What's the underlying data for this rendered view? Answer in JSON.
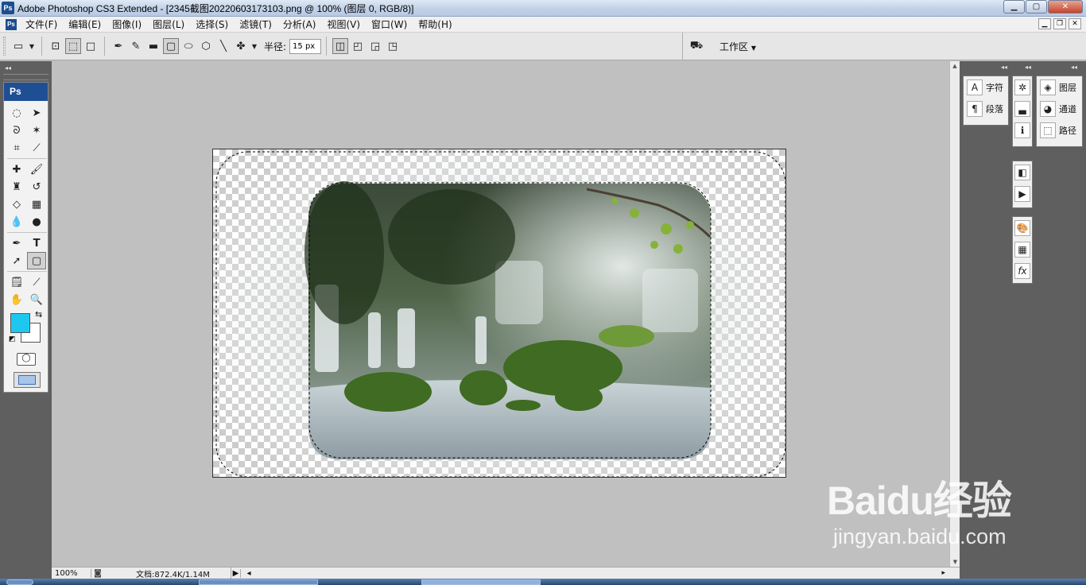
{
  "app": {
    "icon": "Ps",
    "title": "Adobe Photoshop CS3 Extended - [2345截图20220603173103.png @ 100% (图层 0, RGB/8)]"
  },
  "window_controls": [
    "minimize",
    "maximize",
    "close"
  ],
  "menus": [
    "文件(F)",
    "编辑(E)",
    "图像(I)",
    "图层(L)",
    "选择(S)",
    "滤镜(T)",
    "分析(A)",
    "视图(V)",
    "窗口(W)",
    "帮助(H)"
  ],
  "options_bar": {
    "radius_label": "半径:",
    "radius_value": "15 px",
    "workspace_label": "工作区"
  },
  "toolbox": {
    "logo": "Ps",
    "foreground_color": "#1dc8f0",
    "background_color": "#ffffff"
  },
  "panels": {
    "col1": [
      {
        "label": "字符",
        "icon": "character-icon"
      },
      {
        "label": "段落",
        "icon": "paragraph-icon"
      }
    ],
    "col3": [
      {
        "label": "图层",
        "icon": "layers-icon"
      },
      {
        "label": "通道",
        "icon": "channels-icon"
      },
      {
        "label": "路径",
        "icon": "paths-icon"
      }
    ]
  },
  "status": {
    "zoom": "100%",
    "doc_info": "文档:872.4K/1.14M"
  },
  "watermark": {
    "logo": "Baidu经验",
    "url": "jingyan.baidu.com"
  }
}
